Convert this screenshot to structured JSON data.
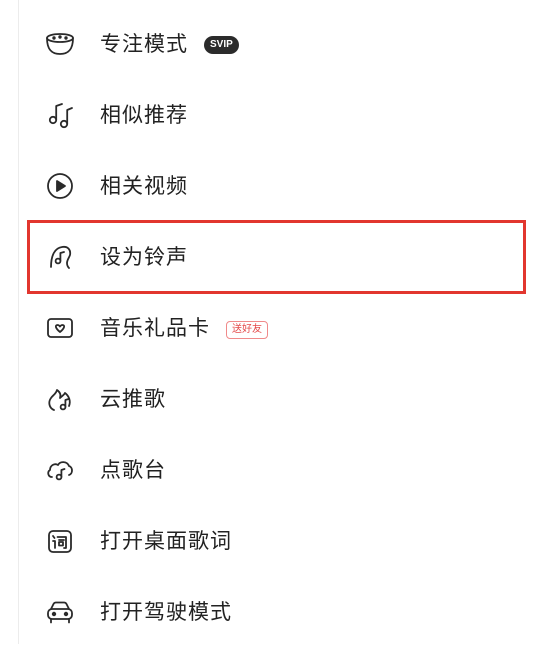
{
  "menu": {
    "items": [
      {
        "icon": "focus-mode-icon",
        "label": "专注模式",
        "badge": "SVIP"
      },
      {
        "icon": "similar-music-icon",
        "label": "相似推荐"
      },
      {
        "icon": "play-video-icon",
        "label": "相关视频"
      },
      {
        "icon": "ringtone-icon",
        "label": "设为铃声"
      },
      {
        "icon": "gift-card-icon",
        "label": "音乐礼品卡",
        "badge": "送好友"
      },
      {
        "icon": "cloud-push-icon",
        "label": "云推歌"
      },
      {
        "icon": "song-request-icon",
        "label": "点歌台"
      },
      {
        "icon": "desktop-lyrics-icon",
        "label": "打开桌面歌词"
      },
      {
        "icon": "car-mode-icon",
        "label": "打开驾驶模式"
      }
    ]
  },
  "highlight": {
    "target_label": "设为铃声",
    "color": "#e2362f"
  }
}
